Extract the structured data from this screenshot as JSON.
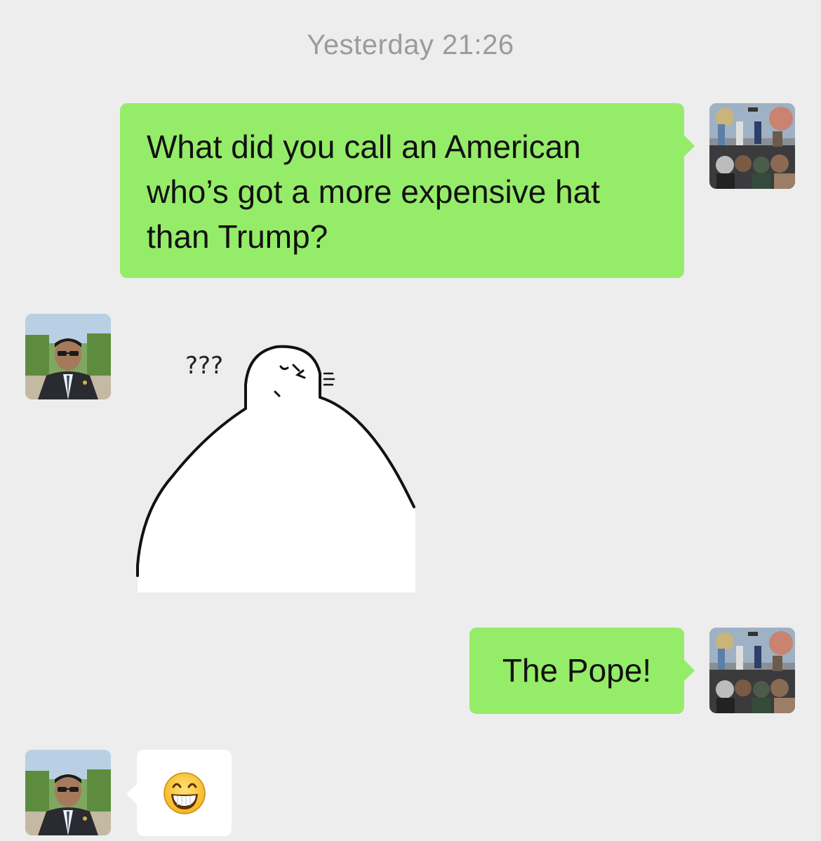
{
  "chat": {
    "timestamp": "Yesterday 21:26",
    "messages": [
      {
        "sender": "me",
        "type": "text",
        "text": "What did you call an American who’s got a more expensive hat than Trump?"
      },
      {
        "sender": "friend",
        "type": "sticker",
        "sticker_caption": "???"
      },
      {
        "sender": "me",
        "type": "text",
        "text": "The Pope!"
      },
      {
        "sender": "friend",
        "type": "emoji",
        "emoji": "grinning-face"
      }
    ]
  },
  "colors": {
    "background": "#ededed",
    "my_bubble": "#95ec69",
    "friend_bubble": "#ffffff",
    "timestamp_text": "#9b9b9b"
  },
  "icons": {
    "my_avatar": "collage-avatar",
    "friend_avatar": "man-in-suit-avatar",
    "reply_emoji": "grinning-face-emoji"
  }
}
